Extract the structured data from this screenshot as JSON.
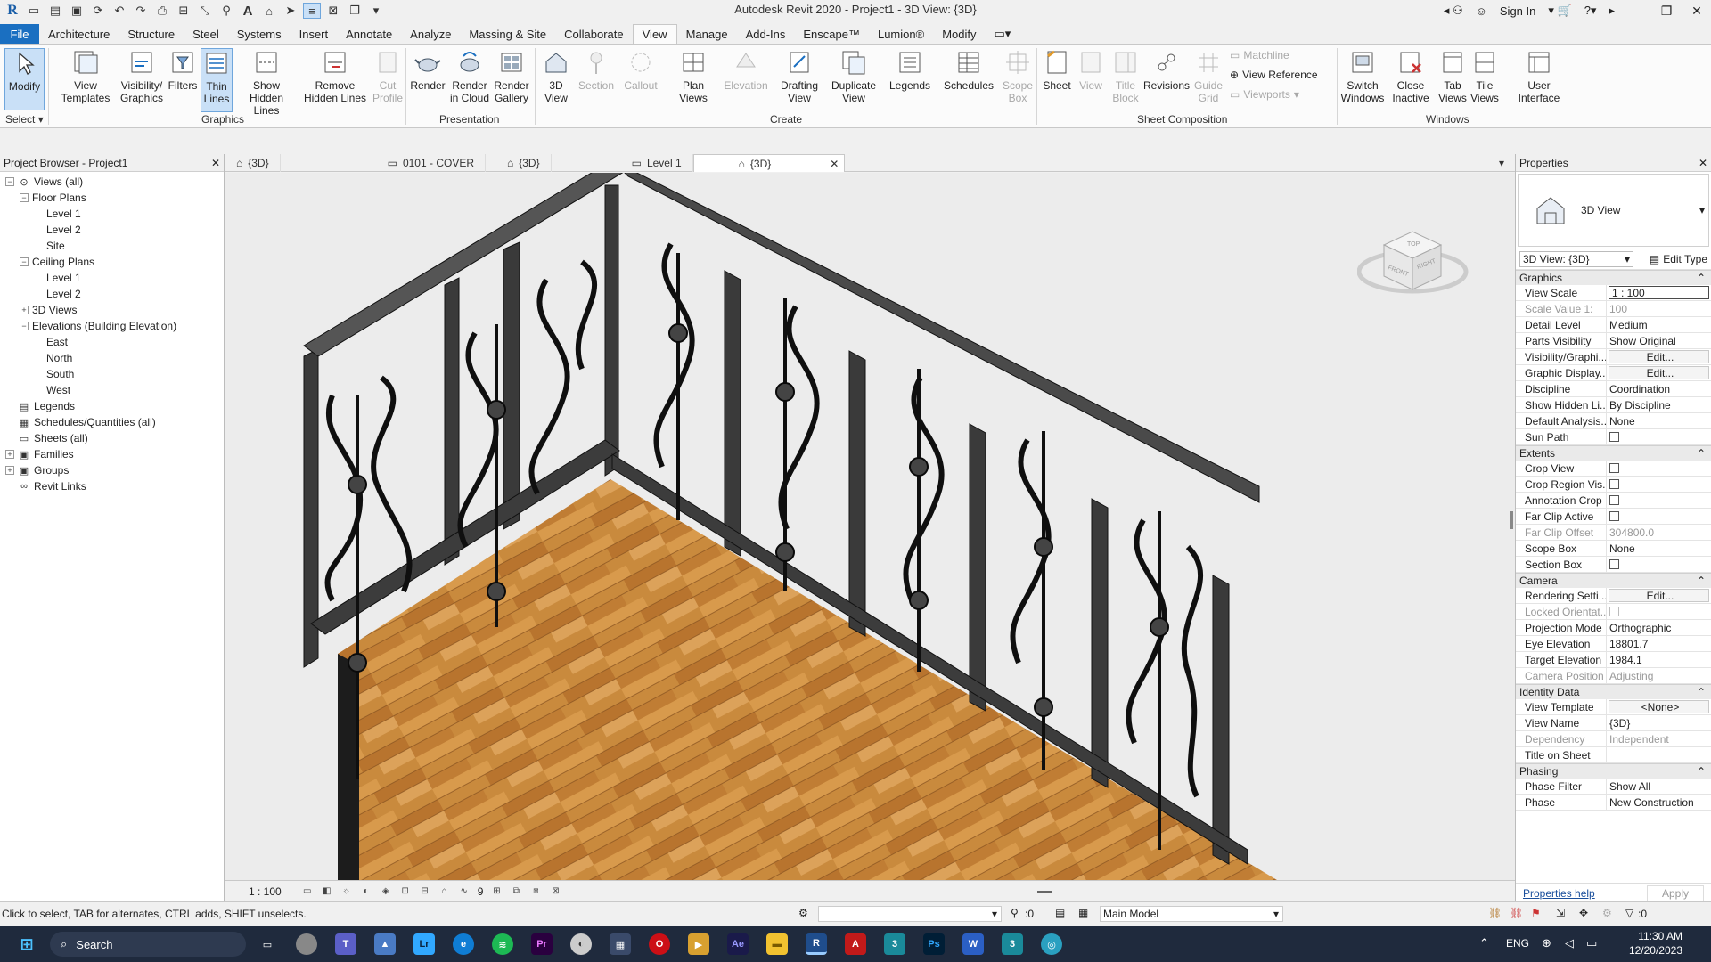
{
  "window": {
    "title": "Autodesk Revit 2020 - Project1 - 3D View: {3D}",
    "sign_in": "Sign In"
  },
  "ribbon_tabs": [
    "File",
    "Architecture",
    "Structure",
    "Steel",
    "Systems",
    "Insert",
    "Annotate",
    "Analyze",
    "Massing & Site",
    "Collaborate",
    "View",
    "Manage",
    "Add-Ins",
    "Enscape™",
    "Lumion®",
    "Modify"
  ],
  "ribbon": {
    "select": {
      "modify": "Modify",
      "label": "Select"
    },
    "graphics": {
      "label": "Graphics",
      "view_templates": [
        "View",
        "Templates"
      ],
      "visibility_graphics": [
        "Visibility/",
        "Graphics"
      ],
      "filters": "Filters",
      "thin_lines": [
        "Thin",
        "Lines"
      ],
      "show_hidden_lines": [
        "Show",
        "Hidden Lines"
      ],
      "remove_hidden_lines": [
        "Remove",
        "Hidden Lines"
      ],
      "cut_profile": [
        "Cut",
        "Profile"
      ]
    },
    "presentation": {
      "label": "Presentation",
      "render": "Render",
      "render_cloud": [
        "Render",
        "in Cloud"
      ],
      "render_gallery": [
        "Render",
        "Gallery"
      ]
    },
    "create": {
      "label": "Create",
      "view_3d": [
        "3D",
        "View"
      ],
      "section": "Section",
      "callout": "Callout",
      "plan_views": [
        "Plan",
        "Views"
      ],
      "elevation": "Elevation",
      "drafting_view": [
        "Drafting",
        "View"
      ],
      "duplicate_view": [
        "Duplicate",
        "View"
      ],
      "legends": "Legends",
      "schedules": "Schedules",
      "scope_box": [
        "Scope",
        "Box"
      ]
    },
    "sheet_composition": {
      "label": "Sheet Composition",
      "sheet": "Sheet",
      "view": "View",
      "title_block": [
        "Title",
        "Block"
      ],
      "revisions": "Revisions",
      "guide_grid": [
        "Guide",
        "Grid"
      ],
      "matchline": "Matchline",
      "view_reference": "View  Reference",
      "viewports": "Viewports"
    },
    "windows": {
      "label": "Windows",
      "switch_windows": [
        "Switch",
        "Windows"
      ],
      "close_inactive": [
        "Close",
        "Inactive"
      ],
      "tab_views": [
        "Tab",
        "Views"
      ],
      "tile_views": [
        "Tile",
        "Views"
      ],
      "user_interface": [
        "User",
        "Interface"
      ]
    }
  },
  "project_browser": {
    "title": "Project Browser - Project1",
    "tree": [
      {
        "label": "Views (all)",
        "depth": 0,
        "tog": "-",
        "icon": "views-icon"
      },
      {
        "label": "Floor Plans",
        "depth": 1,
        "tog": "-"
      },
      {
        "label": "Level 1",
        "depth": 2
      },
      {
        "label": "Level 2",
        "depth": 2
      },
      {
        "label": "Site",
        "depth": 2
      },
      {
        "label": "Ceiling Plans",
        "depth": 1,
        "tog": "-"
      },
      {
        "label": "Level 1",
        "depth": 2
      },
      {
        "label": "Level 2",
        "depth": 2
      },
      {
        "label": "3D Views",
        "depth": 1,
        "tog": "+"
      },
      {
        "label": "Elevations (Building Elevation)",
        "depth": 1,
        "tog": "-"
      },
      {
        "label": "East",
        "depth": 2
      },
      {
        "label": "North",
        "depth": 2
      },
      {
        "label": "South",
        "depth": 2
      },
      {
        "label": "West",
        "depth": 2
      },
      {
        "label": "Legends",
        "depth": 0,
        "icon": "legend-icon"
      },
      {
        "label": "Schedules/Quantities (all)",
        "depth": 0,
        "icon": "schedule-icon"
      },
      {
        "label": "Sheets (all)",
        "depth": 0,
        "icon": "sheet-icon"
      },
      {
        "label": "Families",
        "depth": 0,
        "tog": "+",
        "icon": "family-icon"
      },
      {
        "label": "Groups",
        "depth": 0,
        "tog": "+",
        "icon": "group-icon"
      },
      {
        "label": "Revit Links",
        "depth": 0,
        "icon": "link-icon"
      }
    ]
  },
  "view_tabs": [
    {
      "label": "{3D}",
      "active": false
    },
    {
      "label": "0101 - COVER",
      "active": false
    },
    {
      "label": "{3D}",
      "active": false
    },
    {
      "label": "Level 1",
      "active": false
    },
    {
      "label": "{3D}",
      "active": true
    }
  ],
  "viewcube": {
    "top": "TOP",
    "front": "FRONT",
    "right": "RIGHT"
  },
  "view_control": {
    "scale": "1 : 100",
    "number": "9"
  },
  "properties": {
    "title": "Properties",
    "type_name": "3D View",
    "instance": "3D View: {3D}",
    "edit_type": "Edit Type",
    "sections": [
      {
        "name": "Graphics",
        "rows": [
          {
            "n": "View Scale",
            "v": "1 : 100",
            "style": "boxed"
          },
          {
            "n": "Scale Value    1:",
            "v": "100",
            "dim": true
          },
          {
            "n": "Detail Level",
            "v": "Medium"
          },
          {
            "n": "Parts Visibility",
            "v": "Show Original"
          },
          {
            "n": "Visibility/Graphi...",
            "v": "Edit...",
            "style": "btn"
          },
          {
            "n": "Graphic Display...",
            "v": "Edit...",
            "style": "btn"
          },
          {
            "n": "Discipline",
            "v": "Coordination"
          },
          {
            "n": "Show Hidden Li...",
            "v": "By Discipline"
          },
          {
            "n": "Default Analysis...",
            "v": "None"
          },
          {
            "n": "Sun Path",
            "v": "",
            "style": "cb"
          }
        ]
      },
      {
        "name": "Extents",
        "rows": [
          {
            "n": "Crop View",
            "v": "",
            "style": "cb"
          },
          {
            "n": "Crop Region Vis...",
            "v": "",
            "style": "cb"
          },
          {
            "n": "Annotation Crop",
            "v": "",
            "style": "cb"
          },
          {
            "n": "Far Clip Active",
            "v": "",
            "style": "cb"
          },
          {
            "n": "Far Clip Offset",
            "v": "304800.0",
            "dim": true
          },
          {
            "n": "Scope Box",
            "v": "None"
          },
          {
            "n": "Section Box",
            "v": "",
            "style": "cb"
          }
        ]
      },
      {
        "name": "Camera",
        "rows": [
          {
            "n": "Rendering Setti...",
            "v": "Edit...",
            "style": "btn"
          },
          {
            "n": "Locked Orientat...",
            "v": "",
            "style": "cb",
            "dim": true
          },
          {
            "n": "Projection Mode",
            "v": "Orthographic"
          },
          {
            "n": "Eye Elevation",
            "v": "18801.7"
          },
          {
            "n": "Target Elevation",
            "v": "1984.1"
          },
          {
            "n": "Camera Position",
            "v": "Adjusting",
            "dim": true
          }
        ]
      },
      {
        "name": "Identity Data",
        "rows": [
          {
            "n": "View Template",
            "v": "<None>",
            "style": "btn"
          },
          {
            "n": "View Name",
            "v": "{3D}"
          },
          {
            "n": "Dependency",
            "v": "Independent",
            "dim": true
          },
          {
            "n": "Title on Sheet",
            "v": ""
          }
        ]
      },
      {
        "name": "Phasing",
        "rows": [
          {
            "n": "Phase Filter",
            "v": "Show All"
          },
          {
            "n": "Phase",
            "v": "New Construction"
          }
        ]
      }
    ],
    "help": "Properties help",
    "apply": "Apply"
  },
  "status": {
    "message": "Click to select, TAB for alternates, CTRL adds, SHIFT unselects.",
    "filter_count": ":0",
    "model": "Main Model",
    "sel_count": ":0"
  },
  "taskbar": {
    "search": "Search",
    "lang": "ENG",
    "time": "11:30 AM",
    "date": "12/20/2023"
  },
  "colors": {
    "accent": "#1a6fc1",
    "railing": "#2b2b2b",
    "floor": "#c98a3d",
    "taskbar": "#1f2a3d"
  }
}
